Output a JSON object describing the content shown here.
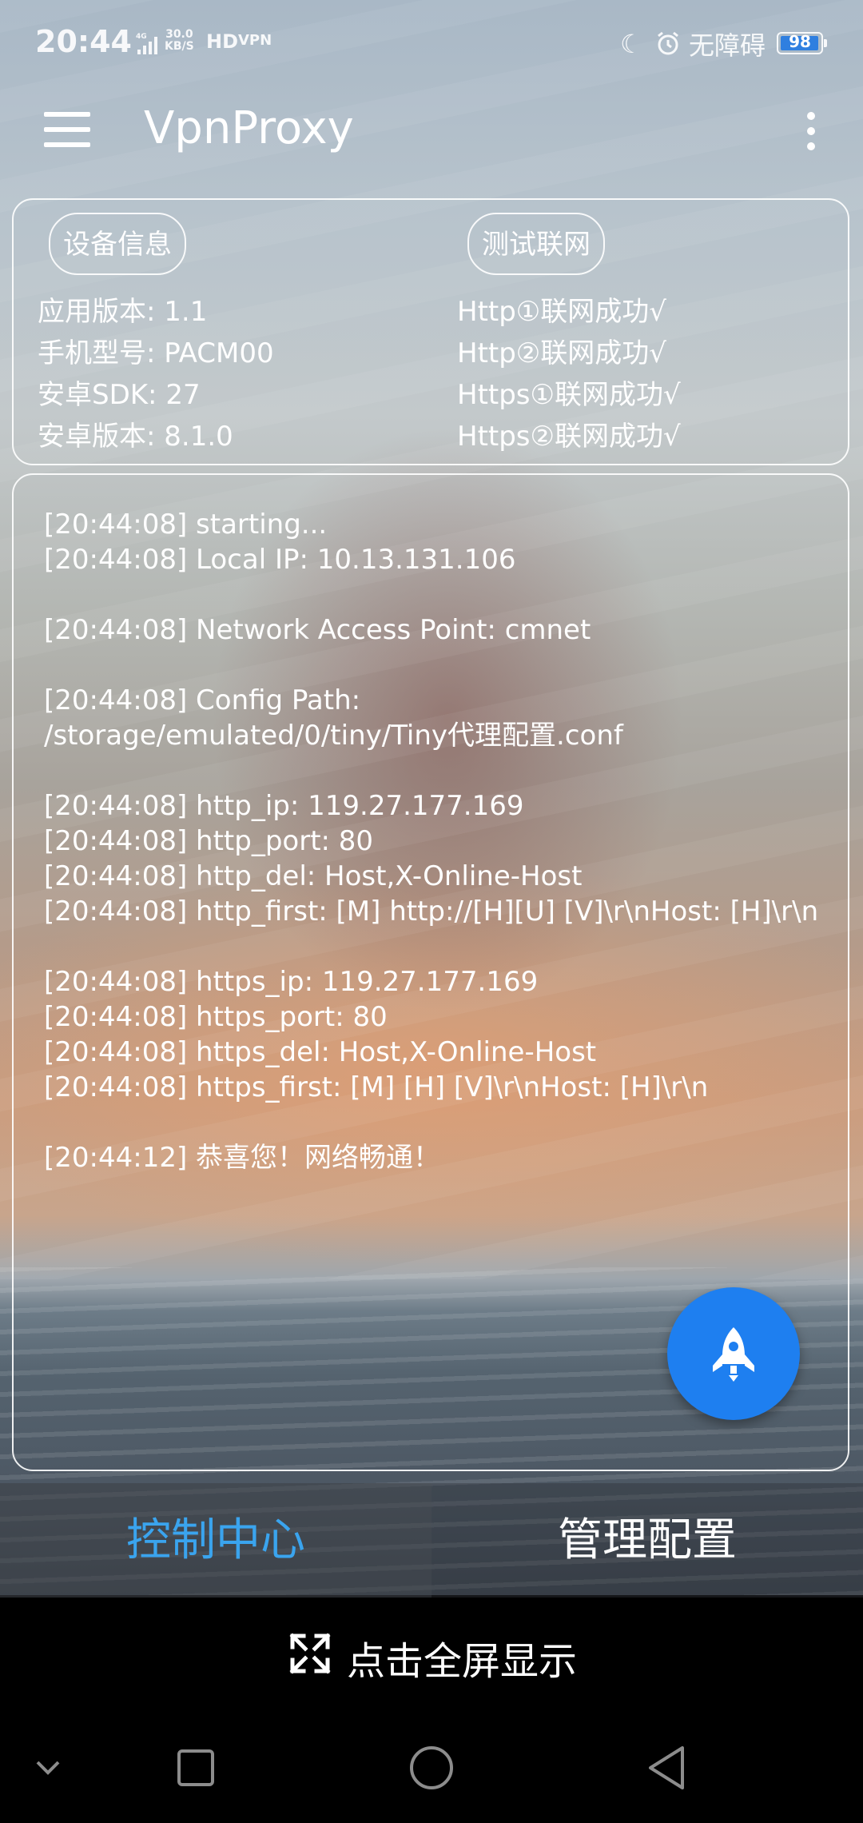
{
  "status_bar": {
    "time": "20:44",
    "network": "4G",
    "speed_value": "30.0",
    "speed_unit": "KB/S",
    "hd": "HD",
    "vpn": "VPN",
    "accessibility": "无障碍",
    "battery": "98",
    "battery_level": 0.98
  },
  "toolbar": {
    "title": "VpnProxy",
    "menu_icon": "hamburger-menu-icon",
    "more_icon": "more-vert-icon"
  },
  "info": {
    "device_info_label": "设备信息",
    "test_network_label": "测试联网",
    "left_lines": [
      "应用版本: 1.1",
      "手机型号: PACM00",
      "安卓SDK: 27",
      "安卓版本: 8.1.0"
    ],
    "right_lines": [
      "Http①联网成功√",
      "Http②联网成功√",
      "Https①联网成功√",
      "Https②联网成功√"
    ]
  },
  "log": {
    "lines": [
      "[20:44:08] starting...",
      "[20:44:08] Local IP: 10.13.131.106",
      "",
      "[20:44:08] Network Access Point: cmnet",
      "",
      "[20:44:08] Config Path:",
      "/storage/emulated/0/tiny/Tiny代理配置.conf",
      "",
      "[20:44:08] http_ip: 119.27.177.169",
      "[20:44:08] http_port: 80",
      "[20:44:08] http_del: Host,X-Online-Host",
      "[20:44:08] http_first: [M] http://[H][U] [V]\\r\\nHost: [H]\\r\\n",
      "",
      "[20:44:08] https_ip: 119.27.177.169",
      "[20:44:08] https_port: 80",
      "[20:44:08] https_del: Host,X-Online-Host",
      "[20:44:08] https_first: [M] [H] [V]\\r\\nHost: [H]\\r\\n",
      "",
      "[20:44:12] 恭喜您！网络畅通！"
    ]
  },
  "fab": {
    "icon": "rocket-icon",
    "color": "#1e7ff0"
  },
  "tabs": [
    {
      "label": "控制中心",
      "active": true
    },
    {
      "label": "管理配置",
      "active": false
    }
  ],
  "fullscreen_hint": {
    "icon": "expand-arrows-icon",
    "label": "点击全屏显示"
  },
  "navbar": {
    "icons": [
      "chevron-down-icon",
      "recent-apps-icon",
      "home-icon",
      "back-icon"
    ]
  },
  "colors": {
    "accent_tab": "#3aa4ee",
    "fab": "#1e7ff0",
    "battery_fill": "#2f7fe0"
  }
}
